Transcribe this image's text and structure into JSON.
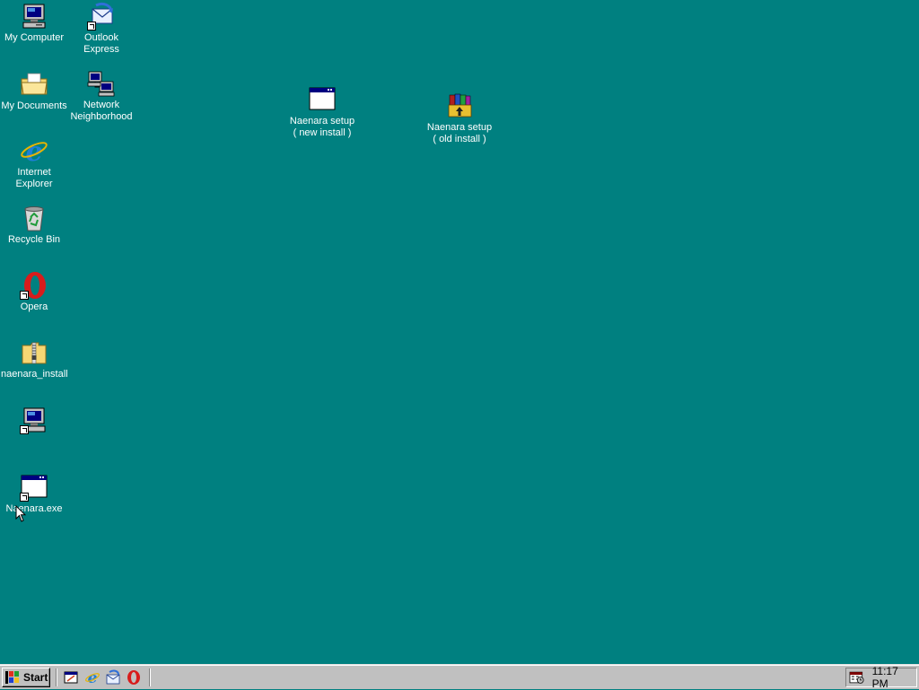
{
  "desktop": {
    "background_color": "#008080",
    "icons": {
      "my_computer": {
        "label": "My Computer",
        "icon": "computer-icon"
      },
      "outlook_express": {
        "label": "Outlook\nExpress",
        "icon": "outlook-express-icon"
      },
      "my_documents": {
        "label": "My Documents",
        "icon": "folder-documents-icon"
      },
      "network_neighborhood": {
        "label": "Network\nNeighborhood",
        "icon": "network-icon"
      },
      "internet_explorer": {
        "label": "Internet\nExplorer",
        "icon": "internet-explorer-icon"
      },
      "recycle_bin": {
        "label": "Recycle Bin",
        "icon": "recycle-bin-icon"
      },
      "opera": {
        "label": "Opera",
        "icon": "opera-icon"
      },
      "naenara_install": {
        "label": "naenara_install",
        "icon": "zip-folder-icon"
      },
      "unnamed_computer_shortcut": {
        "label": "",
        "icon": "computer-shortcut-icon"
      },
      "naenara_exe": {
        "label": "Naenara.exe",
        "icon": "application-window-icon"
      },
      "naenara_setup_new": {
        "label": "Naenara setup\n( new install )",
        "icon": "application-window-icon"
      },
      "naenara_setup_old": {
        "label": "Naenara setup\n( old install )",
        "icon": "winrar-archive-icon"
      }
    }
  },
  "taskbar": {
    "start_label": "Start",
    "quick_launch": [
      "show-desktop-icon",
      "internet-explorer-icon",
      "outlook-express-icon",
      "opera-icon"
    ],
    "clock": "11:17 PM",
    "tray_icon": "scheduler-icon"
  }
}
